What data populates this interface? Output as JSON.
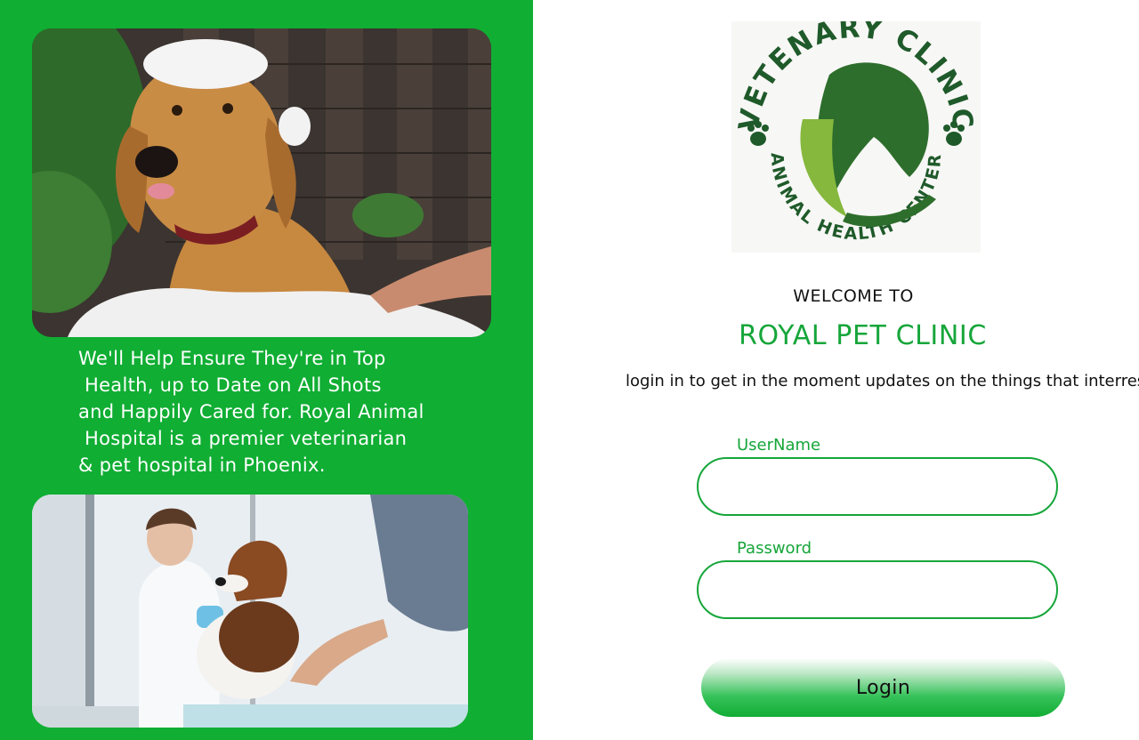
{
  "colors": {
    "brand_green": "#10ae33",
    "accent_green": "#16a63a",
    "background": "#ffffff"
  },
  "promo": {
    "lines": [
      "We'll Help Ensure They're in Top",
      " Health, up to Date on All Shots",
      "and Happily Cared for. Royal Animal",
      " Hospital is a premier veterinarian",
      "& pet hospital in Phoenix."
    ]
  },
  "logo": {
    "top_text": "VETENARY CLINIC",
    "bottom_text": "ANIMAL HEALTH CENTER"
  },
  "welcome": "WELCOME TO",
  "clinic_name": "ROYAL PET CLINIC",
  "tagline": "login in to get in the moment updates on the things that interrest you",
  "form": {
    "username_label": "UserName",
    "username_value": "",
    "password_label": "Password",
    "password_value": "",
    "login_label": "Login"
  }
}
